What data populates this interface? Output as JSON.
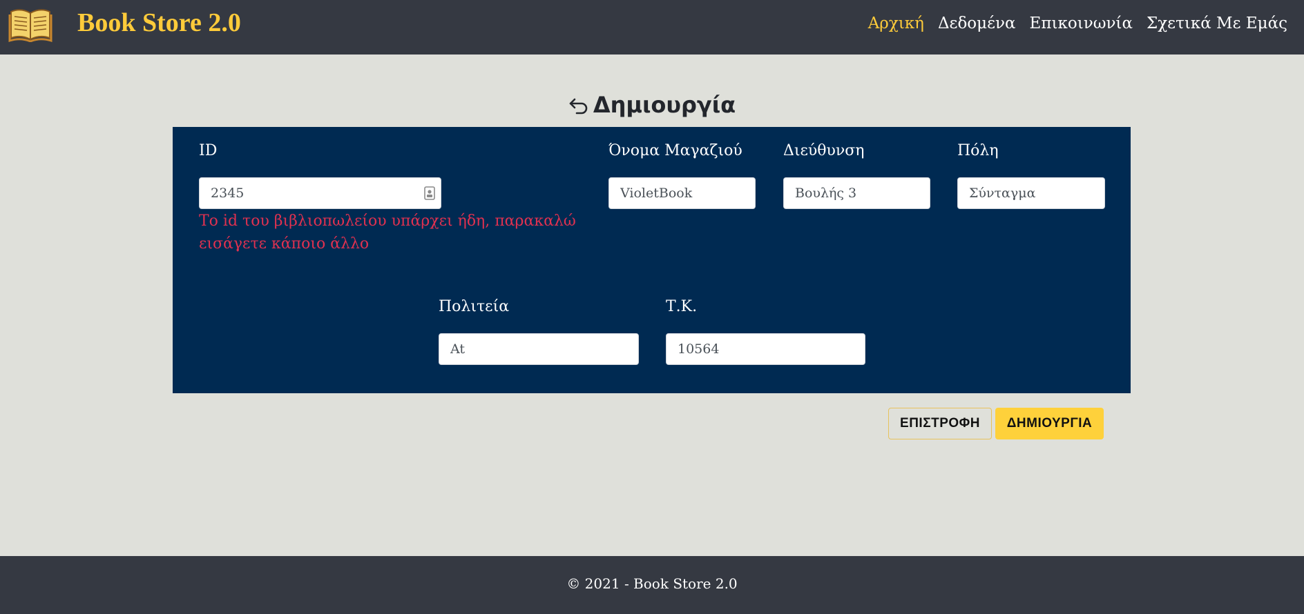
{
  "brand": {
    "title": "Book Store 2.0",
    "logo_icon": "open-book-icon"
  },
  "nav": [
    {
      "label": "Αρχική",
      "active": true
    },
    {
      "label": "Δεδομένα",
      "active": false
    },
    {
      "label": "Επικοινωνία",
      "active": false
    },
    {
      "label": "Σχετικά Με Εμάς",
      "active": false
    }
  ],
  "page": {
    "title": "Δημιουργία",
    "back_icon": "return-arrow-icon"
  },
  "form": {
    "id": {
      "label": "ID",
      "value": "2345",
      "error": "Το id του βιβλιοπωλείου υπάρχει ήδη, παρακαλώ εισάγετε κάποιο άλλο"
    },
    "store_name": {
      "label": "Όνομα Μαγαζιού",
      "value": "VioletBook"
    },
    "address": {
      "label": "Διεύθυνση",
      "value": "Βουλής 3"
    },
    "city": {
      "label": "Πόλη",
      "value": "Σύνταγμα"
    },
    "state": {
      "label": "Πολιτεία",
      "value": "At"
    },
    "zip": {
      "label": "Τ.Κ.",
      "value": "10564"
    }
  },
  "buttons": {
    "back": "ΕΠΙΣΤΡΟΦΗ",
    "create": "ΔΗΜΙΟΥΡΓΙΑ"
  },
  "footer": {
    "text": "© 2021 - Book Store 2.0"
  },
  "colors": {
    "header_bg": "#353942",
    "accent": "#fecb3a",
    "panel_bg": "#002a52",
    "page_bg": "#dfe0da",
    "error": "#e03150"
  }
}
